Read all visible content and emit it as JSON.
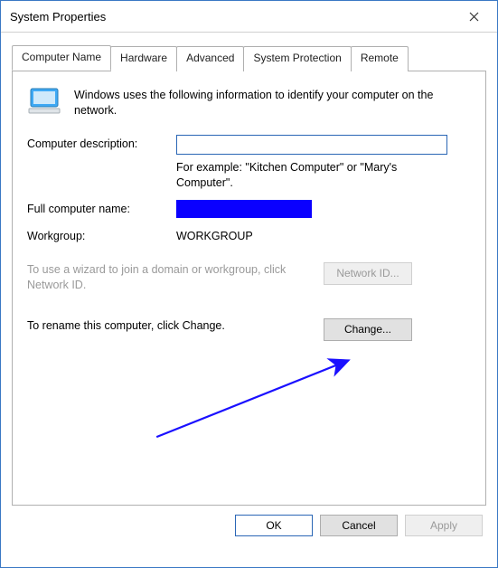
{
  "window": {
    "title": "System Properties",
    "close_tooltip": "Close"
  },
  "tabs": {
    "computer_name": "Computer Name",
    "hardware": "Hardware",
    "advanced": "Advanced",
    "system_protection": "System Protection",
    "remote": "Remote"
  },
  "page": {
    "intro": "Windows uses the following information to identify your computer on the network.",
    "description_label": "Computer description:",
    "description_value": "",
    "description_hint": "For example: \"Kitchen Computer\" or \"Mary's Computer\".",
    "fullname_label": "Full computer name:",
    "fullname_value": "",
    "workgroup_label": "Workgroup:",
    "workgroup_value": "WORKGROUP",
    "networkid_text": "To use a wizard to join a domain or workgroup, click Network ID.",
    "networkid_button": "Network ID...",
    "change_text": "To rename this computer, click Change.",
    "change_button": "Change..."
  },
  "buttons": {
    "ok": "OK",
    "cancel": "Cancel",
    "apply": "Apply"
  },
  "colors": {
    "accent": "#2a66b5",
    "arrow": "#1a10ff",
    "redaction": "#0a00ff"
  }
}
